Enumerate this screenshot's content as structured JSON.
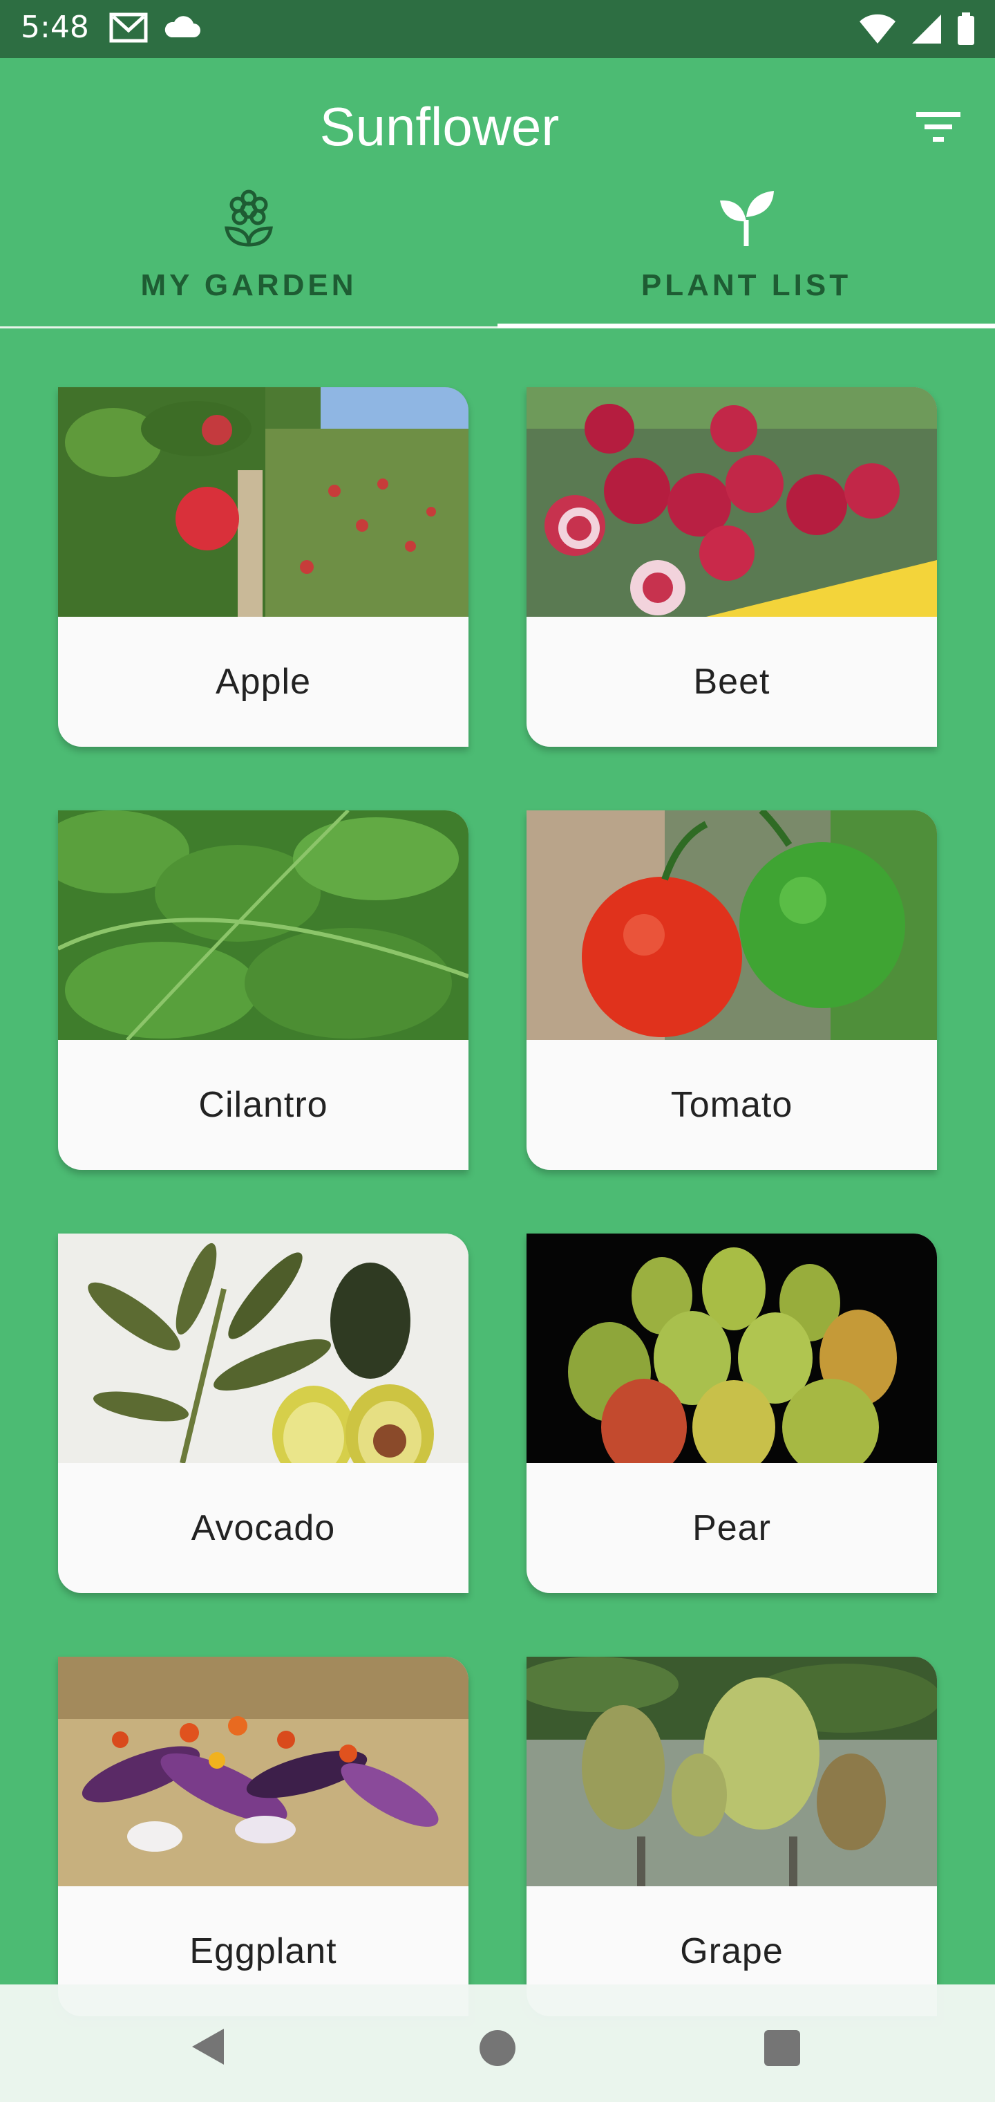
{
  "status_bar": {
    "time": "5:48",
    "left_icons": [
      "gmail-icon",
      "cloud-icon"
    ],
    "right_icons": [
      "wifi-icon",
      "signal-icon",
      "battery-icon"
    ]
  },
  "app_bar": {
    "title": "Sunflower",
    "filter_icon": "filter-icon"
  },
  "tabs": [
    {
      "label": "MY GARDEN",
      "icon": "flower-icon",
      "selected": false
    },
    {
      "label": "PLANT LIST",
      "icon": "sprout-icon",
      "selected": true
    }
  ],
  "plants": [
    {
      "name": "Apple"
    },
    {
      "name": "Beet"
    },
    {
      "name": "Cilantro"
    },
    {
      "name": "Tomato"
    },
    {
      "name": "Avocado"
    },
    {
      "name": "Pear"
    },
    {
      "name": "Eggplant"
    },
    {
      "name": "Grape"
    }
  ],
  "nav_bar": {
    "back_icon": "back-icon",
    "home_icon": "home-icon",
    "recents_icon": "recents-icon"
  },
  "colors": {
    "primary": "#4cbb73",
    "status_bar": "#2d6e42",
    "tab_text": "#1e5c33",
    "card_bg": "#fafafa"
  }
}
